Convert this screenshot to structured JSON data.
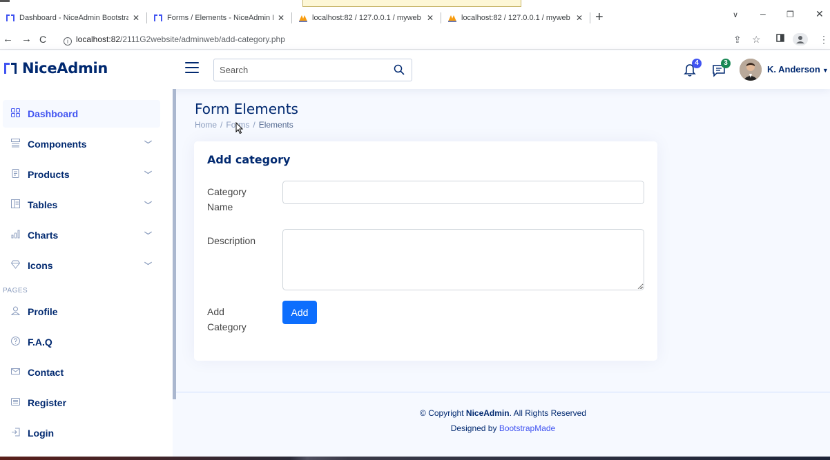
{
  "browser": {
    "tabs": [
      {
        "title": "Dashboard - NiceAdmin Bootstrap Template",
        "active": true
      },
      {
        "title": "Forms / Elements - NiceAdmin Bootstrap Template",
        "active": false
      },
      {
        "title": "localhost:82 / 127.0.0.1 / myweb",
        "active": false
      },
      {
        "title": "localhost:82 / 127.0.0.1 / myweb",
        "active": false
      }
    ],
    "url_host": "localhost:82",
    "url_path": "/2111G2website/adminweb/add-category.php"
  },
  "header": {
    "brand": "NiceAdmin",
    "search_placeholder": "Search",
    "notifications_count": "4",
    "messages_count": "3",
    "username": "K. Anderson",
    "colors": {
      "notif_badge": "#4154f1",
      "msg_badge": "#198754"
    }
  },
  "sidebar": {
    "items": [
      {
        "label": "Dashboard",
        "icon": "grid-icon"
      },
      {
        "label": "Components",
        "icon": "menu-button-icon"
      },
      {
        "label": "Products",
        "icon": "journal-text-icon"
      },
      {
        "label": "Tables",
        "icon": "layout-text-icon"
      },
      {
        "label": "Charts",
        "icon": "bar-chart-icon"
      },
      {
        "label": "Icons",
        "icon": "gem-icon"
      }
    ],
    "pages_heading": "PAGES",
    "pages": [
      {
        "label": "Profile",
        "icon": "person-icon"
      },
      {
        "label": "F.A.Q",
        "icon": "question-circle-icon"
      },
      {
        "label": "Contact",
        "icon": "envelope-icon"
      },
      {
        "label": "Register",
        "icon": "card-list-icon"
      },
      {
        "label": "Login",
        "icon": "box-arrow-in-right-icon"
      }
    ]
  },
  "page": {
    "title": "Form Elements",
    "breadcrumb": [
      "Home",
      "Forms",
      "Elements"
    ]
  },
  "form": {
    "card_title": "Add category",
    "category_name_label_1": "Category",
    "category_name_label_2": "Name",
    "category_name_value": "",
    "description_label": "Description",
    "description_value": "",
    "add_category_label_1": "Add",
    "add_category_label_2": "Category",
    "add_button": "Add"
  },
  "footer": {
    "copyright_prefix": "© Copyright",
    "brand": "NiceAdmin",
    "copyright_suffix": ". All Rights Reserved",
    "designed_by": "Designed by",
    "credit": "BootstrapMade"
  }
}
